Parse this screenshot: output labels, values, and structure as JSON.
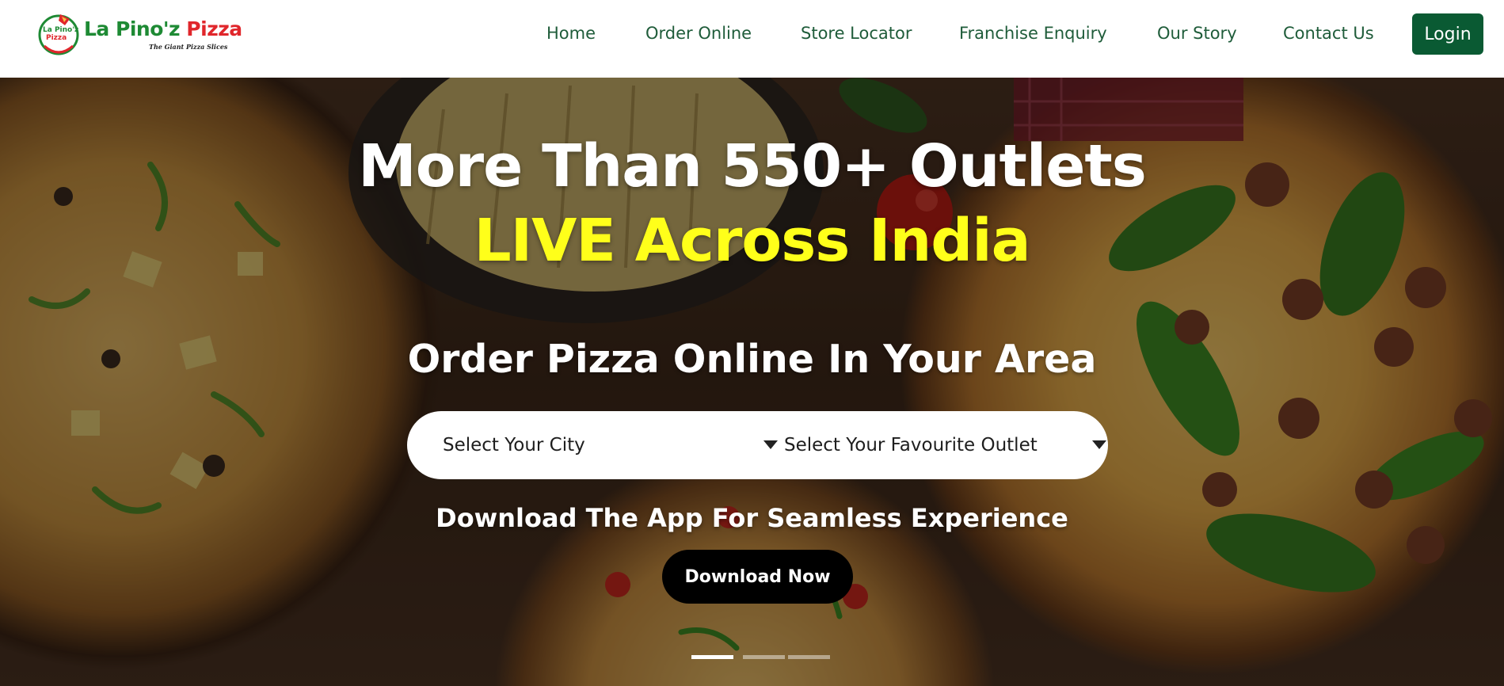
{
  "brand": {
    "name_part1": "La Pino'z",
    "name_part2": "Pizza",
    "tagline": "The Giant Pizza Slices",
    "badge_line1": "La Pino'z",
    "badge_line2": "Pizza"
  },
  "nav": {
    "items": [
      {
        "label": "Home"
      },
      {
        "label": "Order Online"
      },
      {
        "label": "Store Locator"
      },
      {
        "label": "Franchise Enquiry"
      },
      {
        "label": "Our Story"
      },
      {
        "label": "Contact Us"
      }
    ],
    "login_label": "Login"
  },
  "hero": {
    "headline_line1": "More Than 550+ Outlets",
    "headline_line2": "LIVE Across India",
    "subhead": "Order Pizza Online In Your Area",
    "city_select": "Select Your City",
    "outlet_select": "Select Your Favourite Outlet",
    "app_text": "Download The App For Seamless Experience",
    "download_label": "Download Now",
    "slides": 3,
    "active_slide": 1
  },
  "colors": {
    "nav_text": "#1f5c3a",
    "login_bg": "#0a5a33",
    "highlight_yellow": "#ffff1a",
    "brand_green": "#1e8a34",
    "brand_red": "#e0262b"
  }
}
